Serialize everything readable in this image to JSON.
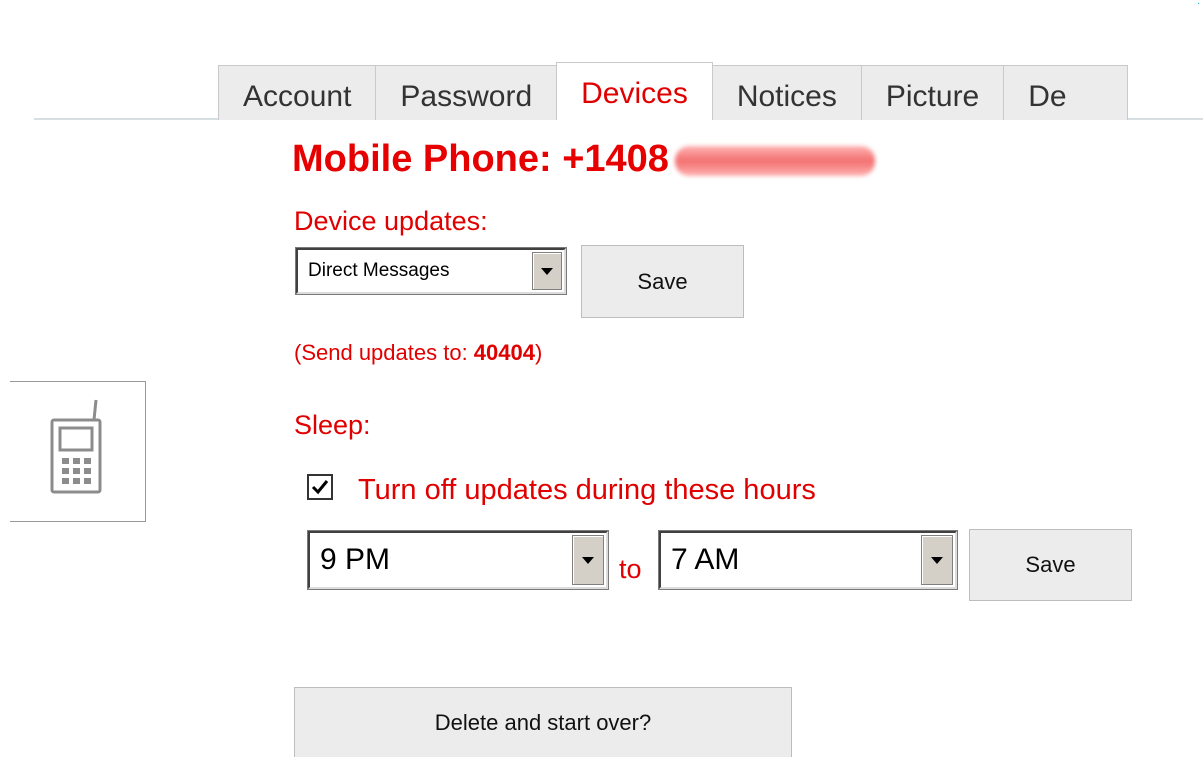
{
  "tabs": [
    {
      "label": "Account",
      "active": false
    },
    {
      "label": "Password",
      "active": false
    },
    {
      "label": "Devices",
      "active": true
    },
    {
      "label": "Notices",
      "active": false
    },
    {
      "label": "Picture",
      "active": false
    },
    {
      "label": "De",
      "active": false
    }
  ],
  "device": {
    "heading": "Mobile Phone: +1408",
    "updates_label": "Device updates:",
    "updates_select_value": "Direct Messages",
    "save_label": "Save",
    "send_note_prefix": "(Send updates to: ",
    "send_number": "40404",
    "send_note_suffix": ")"
  },
  "sleep": {
    "label": "Sleep:",
    "checkbox_checked": true,
    "checkbox_label": "Turn off updates during these hours",
    "from_value": "9 PM",
    "to_label": "to",
    "to_value": "7 AM",
    "save_label": "Save"
  },
  "delete_label": "Delete and start over?",
  "icons": {
    "device": "mobile-phone-icon",
    "dropdown": "chevron-down-icon",
    "check": "check-icon"
  },
  "colors": {
    "accent": "#e10000",
    "tab_bg": "#ececec",
    "button_bg": "#ececec"
  }
}
